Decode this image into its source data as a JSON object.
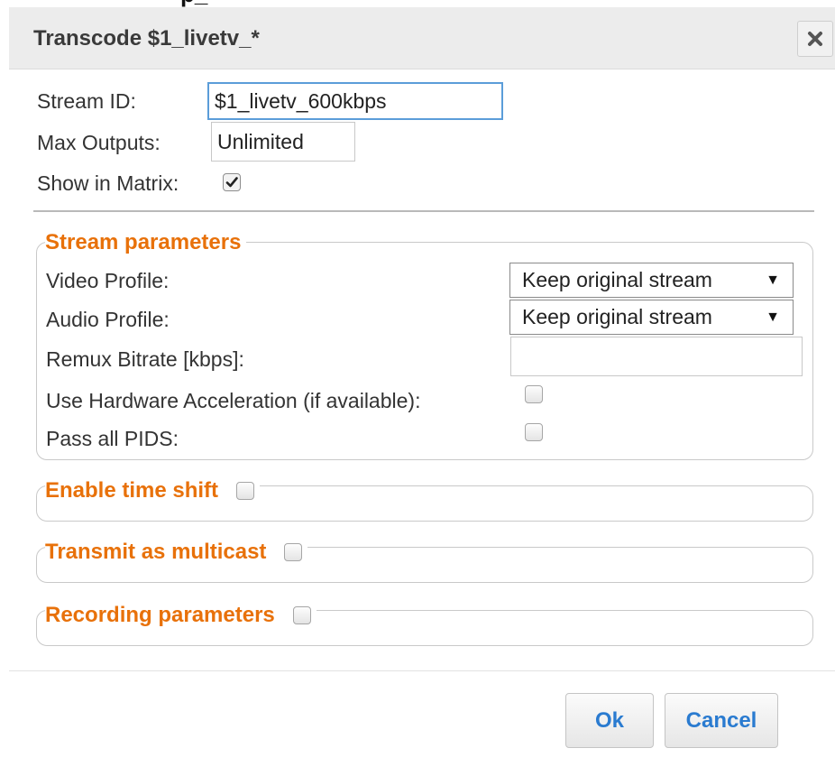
{
  "background_header_fragment": "p_",
  "dialog": {
    "title": "Transcode $1_livetv_*",
    "close_icon": "close-x-icon"
  },
  "form": {
    "stream_id": {
      "label": "Stream ID:",
      "value": "$1_livetv_600kbps"
    },
    "max_outputs": {
      "label": "Max Outputs:",
      "value": "Unlimited"
    },
    "show_in_matrix": {
      "label": "Show in Matrix:",
      "checked": true
    }
  },
  "stream_parameters": {
    "legend": "Stream parameters",
    "video_profile": {
      "label": "Video Profile:",
      "selected": "Keep original stream"
    },
    "audio_profile": {
      "label": "Audio Profile:",
      "selected": "Keep original stream"
    },
    "remux_bitrate": {
      "label": "Remux Bitrate [kbps]:",
      "value": ""
    },
    "hardware_accel": {
      "label": "Use Hardware Acceleration (if available):",
      "checked": false
    },
    "pass_all_pids": {
      "label": "Pass all PIDS:",
      "checked": false
    }
  },
  "sections": {
    "time_shift": {
      "legend": "Enable time shift",
      "checked": false
    },
    "multicast": {
      "legend": "Transmit as multicast",
      "checked": false
    },
    "recording": {
      "legend": "Recording parameters",
      "checked": false
    }
  },
  "buttons": {
    "ok": "Ok",
    "cancel": "Cancel"
  },
  "colors": {
    "accent_orange": "#e8710a",
    "button_text_blue": "#2a7bd0",
    "focus_blue": "#5b9dd9"
  }
}
